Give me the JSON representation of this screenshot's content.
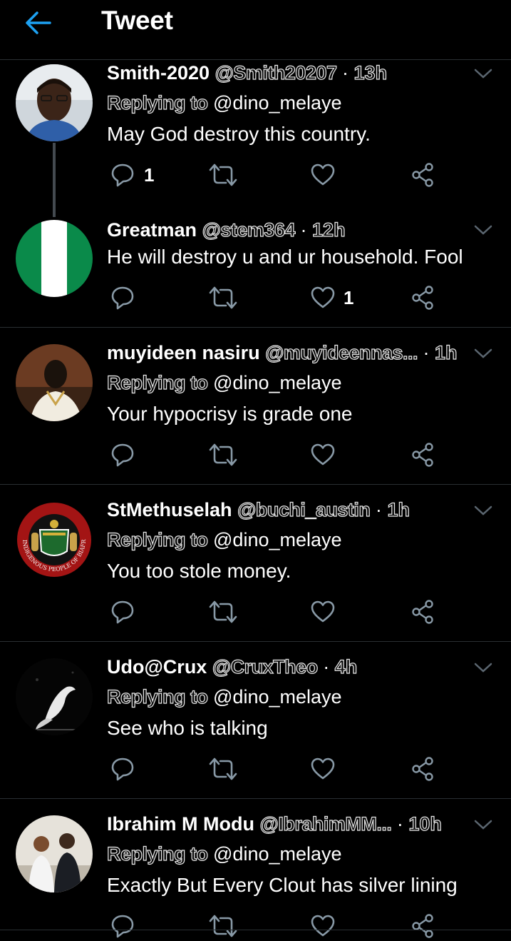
{
  "header": {
    "title": "Tweet"
  },
  "tweets": [
    {
      "name": "Smith-2020",
      "handle": "@Smith20207",
      "time": "13h",
      "replying_label": "Replying to",
      "replying_handle": "@dino_melaye",
      "text": "May God destroy this country.",
      "reply_count": "1",
      "like_count": ""
    },
    {
      "name": "Greatman",
      "handle": "@stem364",
      "time": "12h",
      "replying_label": "",
      "replying_handle": "",
      "text": "He will destroy u and ur household. Fool",
      "reply_count": "",
      "like_count": "1"
    },
    {
      "name": "muyideen nasiru",
      "handle": "@muyideennas...",
      "time": "1h",
      "replying_label": "Replying to",
      "replying_handle": "@dino_melaye",
      "text": "Your hypocrisy is grade one",
      "reply_count": "",
      "like_count": ""
    },
    {
      "name": "StMethuselah",
      "handle": "@buchi_austin",
      "time": "1h",
      "replying_label": "Replying to",
      "replying_handle": "@dino_melaye",
      "text": "You too stole money.",
      "reply_count": "",
      "like_count": "",
      "avatar_text": "INDIGENOUS PEOPLE OF BIAFRA"
    },
    {
      "name": "Udo@Crux",
      "handle": "@CruxTheo",
      "time": "4h",
      "replying_label": "Replying to",
      "replying_handle": "@dino_melaye",
      "text": "See who is talking",
      "reply_count": "",
      "like_count": ""
    },
    {
      "name": "Ibrahim M Modu",
      "handle": "@IbrahimMM...",
      "time": "10h",
      "replying_label": "Replying to",
      "replying_handle": "@dino_melaye",
      "text": "Exactly But Every Clout has silver lining",
      "reply_count": "",
      "like_count": ""
    }
  ],
  "icons": {
    "back": "arrow-left-icon",
    "caret": "chevron-down-icon",
    "reply": "reply-icon",
    "retweet": "retweet-icon",
    "like": "heart-icon",
    "share": "share-icon"
  },
  "colors": {
    "accent": "#1da1f2",
    "background": "#000000",
    "icon": "#8899a6",
    "divider": "#2a2f33"
  }
}
